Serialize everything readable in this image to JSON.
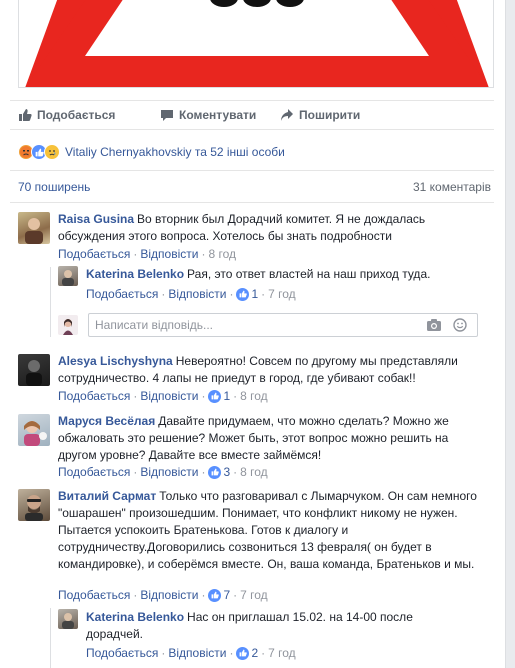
{
  "actions": {
    "like": "Подобається",
    "comment": "Коментувати",
    "share": "Поширити"
  },
  "reactions": {
    "text": "Vitaliy Chernyakhovskiy та 52 інші особи",
    "icons": [
      "angry-icon",
      "like-icon",
      "sad-icon"
    ]
  },
  "stats": {
    "shares": "70 поширень",
    "comments": "31 коментарів"
  },
  "comment_actions": {
    "like": "Подобається",
    "reply": "Відповісти"
  },
  "reply_input": {
    "placeholder": "Написати відповідь..."
  },
  "comments": [
    {
      "author": "Raisa Gusina",
      "text": "Во вторник был Дорадчий комитет. Я не дождалась обсуждения этого вопроса. Хотелось бы знать подробности",
      "likes": "",
      "time": "8 год"
    },
    {
      "author": "Katerina Belenko",
      "text": "Рая, это ответ властей на наш приход туда.",
      "likes": "1",
      "time": "7 год"
    },
    {
      "author": "Alesya Lischyshyna",
      "text": "Невероятно! Совсем по другому мы представляли сотрудничество. 4 лапы не приедут в город, где убивают собак!!",
      "likes": "1",
      "time": "8 год"
    },
    {
      "author": "Маруся Весёлая",
      "text": "Давайте придумаем, что можно сделать? Можно же обжаловать это решение? Может быть, этот вопрос можно решить на другом уровне? Давайте все вместе займёмся!",
      "likes": "3",
      "time": "8 год"
    },
    {
      "author": "Виталий Сармат",
      "text": "Только что разговаривал с Лымарчуком. Он сам немного \"ошарашен\" произошедшим. Понимает, что конфликт никому не нужен. Пытается успокоить Братенькова. Готов к диалогу и сотрудничеству.Договорились созвониться 13 февраля( он будет в командировке), и соберёмся вместе. Он, ваша команда, Братеньков и мы.",
      "likes": "7",
      "time": "7 год"
    },
    {
      "author": "Katerina Belenko",
      "text": "Нас он приглашал 15.02. на 14-00 после дорадчей.",
      "likes": "2",
      "time": "7 год"
    }
  ],
  "colors": {
    "link": "#365899",
    "meta": "#90949c",
    "like_blue": "#5890ff",
    "angry": "#f0a13a",
    "sad": "#f7c23b",
    "sign_red": "#e8261f"
  }
}
